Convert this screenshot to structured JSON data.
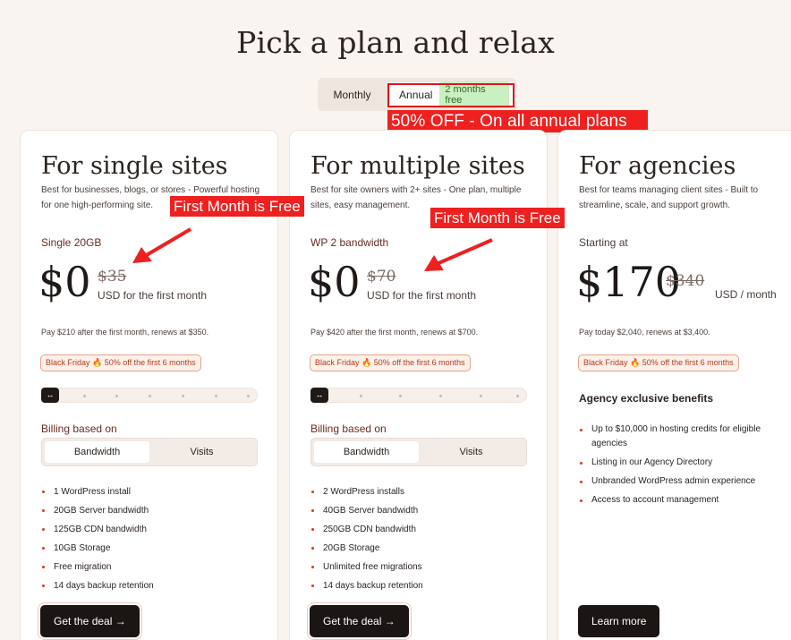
{
  "page": {
    "title": "Pick a plan and relax"
  },
  "billing_toggle": {
    "monthly": "Monthly",
    "annual": "Annual",
    "badge": "2 months free"
  },
  "annotations": {
    "annual_banner": "50% OFF - On all annual plans",
    "free_month_1": "First Month is Free",
    "free_month_2": "First Month is Free",
    "color": "#ee2020"
  },
  "plans": [
    {
      "title": "For single sites",
      "description": "Best for businesses, blogs, or stores - Powerful hosting for one high-performing site.",
      "tier": "Single 20GB",
      "price": "$0",
      "old_price": "$35",
      "price_note": "USD for the first month",
      "renew": "Pay $210 after the first month, renews at $350.",
      "promo": "Black Friday 🔥 50% off the first 6 months",
      "slider_icon": "↔",
      "billing_label": "Billing based on",
      "billing_options": [
        "Bandwidth",
        "Visits"
      ],
      "features": [
        "1 WordPress install",
        "20GB Server bandwidth",
        "125GB CDN bandwidth",
        "10GB Storage",
        "Free migration",
        "14 days backup retention"
      ],
      "cta": "Get the deal →"
    },
    {
      "title": "For multiple sites",
      "description": "Best for site owners with 2+ sites - One plan, multiple sites, easy management.",
      "tier": "WP 2 bandwidth",
      "price": "$0",
      "old_price": "$70",
      "price_note": "USD for the first month",
      "renew": "Pay $420 after the first month, renews at $700.",
      "promo": "Black Friday 🔥 50% off the first 6 months",
      "slider_icon": "↔",
      "billing_label": "Billing based on",
      "billing_options": [
        "Bandwidth",
        "Visits"
      ],
      "features": [
        "2 WordPress installs",
        "40GB Server bandwidth",
        "250GB CDN bandwidth",
        "20GB Storage",
        "Unlimited free migrations",
        "14 days backup retention"
      ],
      "cta": "Get the deal →"
    },
    {
      "title": "For agencies",
      "description": "Best for teams managing client sites - Built to streamline, scale, and support growth.",
      "tier": "Starting at",
      "price": "$170",
      "old_price": "$340",
      "price_note": "USD / month",
      "renew": "Pay today $2,040, renews at $3,400.",
      "promo": "Black Friday 🔥 50% off the first 6 months",
      "benefits_title": "Agency exclusive benefits",
      "features": [
        "Up to $10,000 in hosting credits for eligible agencies",
        "Listing in our Agency Directory",
        "Unbranded WordPress admin experience",
        "Access to account management"
      ],
      "cta": "Learn more"
    }
  ]
}
